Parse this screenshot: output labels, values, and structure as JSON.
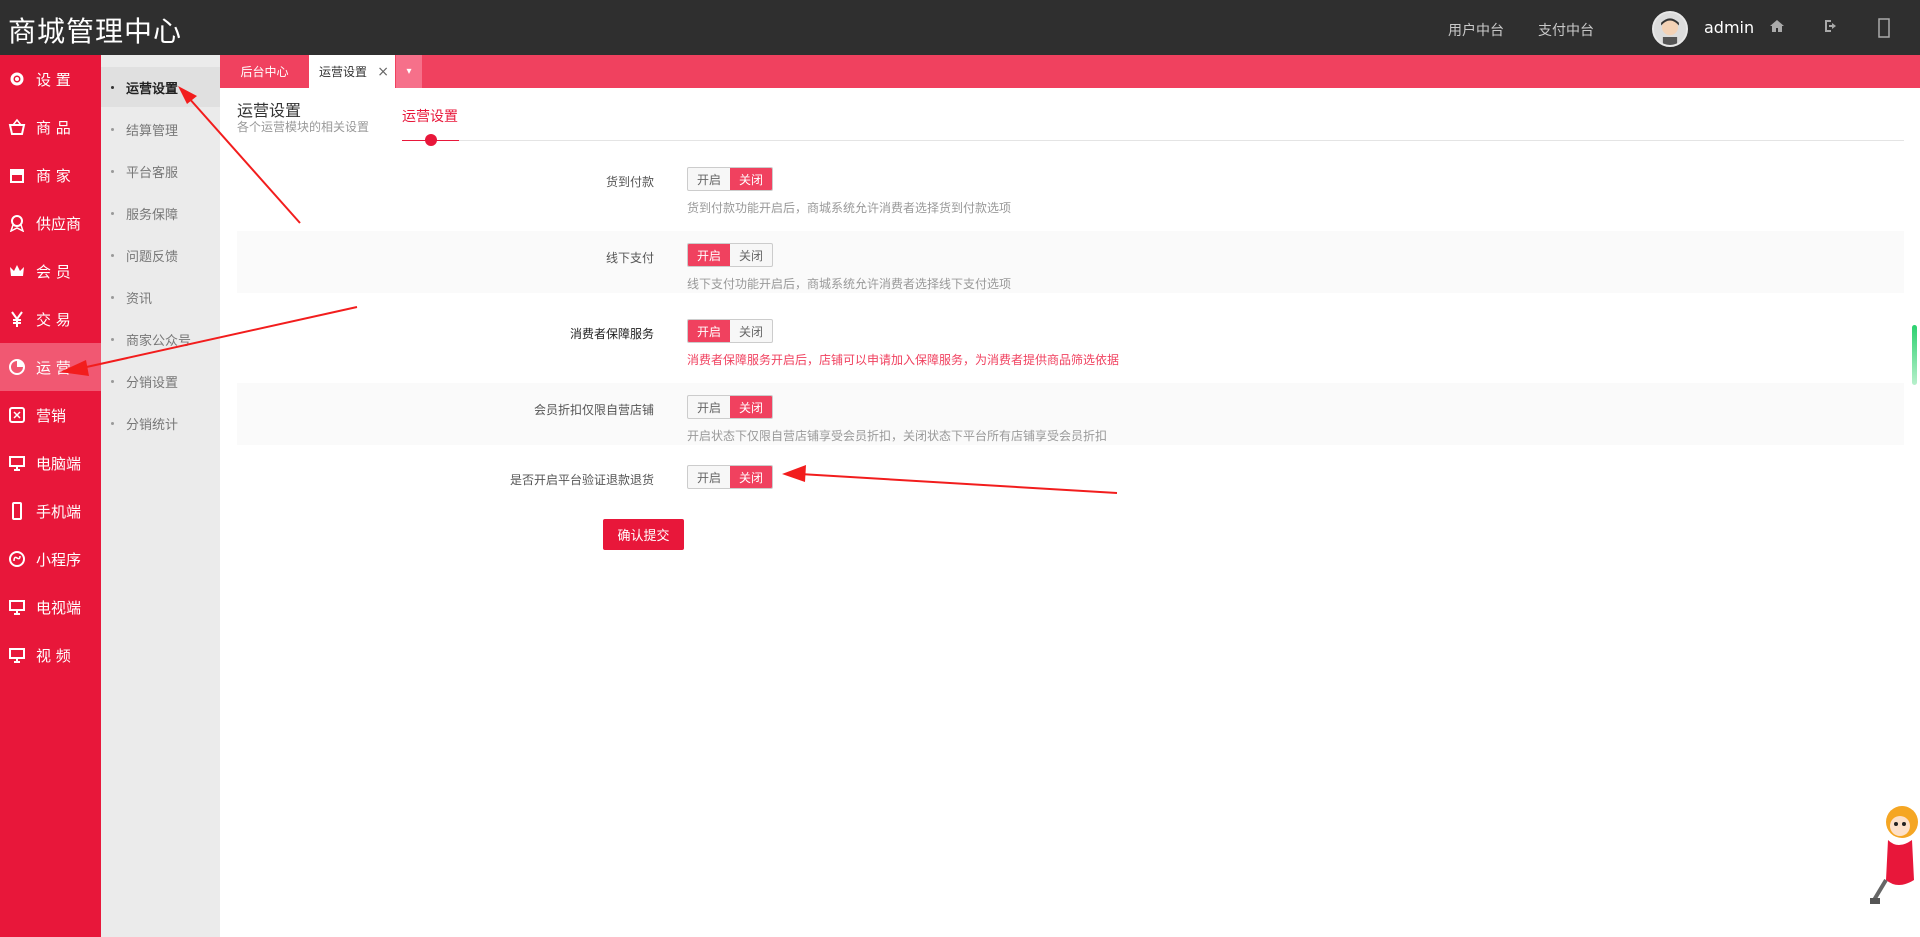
{
  "header": {
    "brand": "商城管理中心",
    "links": [
      "用户中台",
      "支付中台"
    ],
    "username": "admin"
  },
  "sidebar": {
    "items": [
      {
        "label": "设 置",
        "icon": "gear-icon"
      },
      {
        "label": "商 品",
        "icon": "basket-icon"
      },
      {
        "label": "商 家",
        "icon": "store-icon"
      },
      {
        "label": "供应商",
        "icon": "badge-icon"
      },
      {
        "label": "会 员",
        "icon": "crown-icon"
      },
      {
        "label": "交 易",
        "icon": "yen-icon"
      },
      {
        "label": "运 营",
        "icon": "pie-chart-icon",
        "active": true
      },
      {
        "label": "营销",
        "icon": "coupon-icon"
      },
      {
        "label": "电脑端",
        "icon": "monitor-icon"
      },
      {
        "label": "手机端",
        "icon": "mobile-icon"
      },
      {
        "label": "小程序",
        "icon": "miniprogram-icon"
      },
      {
        "label": "电视端",
        "icon": "tv-icon"
      },
      {
        "label": "视 频",
        "icon": "video-icon"
      }
    ]
  },
  "subsidebar": {
    "items": [
      {
        "label": "运营设置",
        "active": true
      },
      {
        "label": "结算管理"
      },
      {
        "label": "平台客服"
      },
      {
        "label": "服务保障"
      },
      {
        "label": "问题反馈"
      },
      {
        "label": "资讯"
      },
      {
        "label": "商家公众号"
      },
      {
        "label": "分销设置"
      },
      {
        "label": "分销统计"
      }
    ]
  },
  "tabs": {
    "home": "后台中心",
    "current": "运营设置",
    "close": "×",
    "more": "▾"
  },
  "page": {
    "title": "运营设置",
    "subtitle": "各个运营模块的相关设置",
    "subtab": "运营设置"
  },
  "switch_labels": {
    "on": "开启",
    "off": "关闭"
  },
  "settings": [
    {
      "label": "货到付款",
      "value": "关闭",
      "hint": "货到付款功能开启后，商城系统允许消费者选择货到付款选项"
    },
    {
      "label": "线下支付",
      "value": "开启",
      "hint": "线下支付功能开启后，商城系统允许消费者选择线下支付选项"
    },
    {
      "label": "消费者保障服务",
      "value": "开启",
      "hint": "消费者保障服务开启后，店铺可以申请加入保障服务，为消费者提供商品筛选依据"
    },
    {
      "label": "会员折扣仅限自营店铺",
      "value": "关闭",
      "hint": "开启状态下仅限自营店铺享受会员折扣，关闭状态下平台所有店铺享受会员折扣"
    },
    {
      "label": "是否开启平台验证退款退货",
      "value": "关闭",
      "hint": ""
    }
  ],
  "submit_label": "确认提交",
  "colors": {
    "accent": "#e8173a",
    "topbar": "#2f2f2f",
    "tabbar": "#f0415f"
  }
}
